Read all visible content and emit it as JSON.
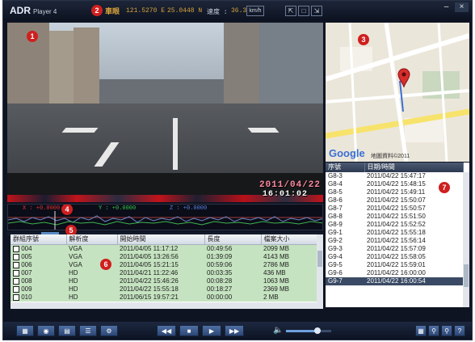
{
  "app": {
    "title": "ADR",
    "subtitle": "Player 4"
  },
  "badges": [
    "1",
    "2",
    "3",
    "4",
    "5",
    "6",
    "7"
  ],
  "header": {
    "logo_text": "車眼",
    "longitude": "121.5270 E",
    "latitude": "25.0448 N",
    "speed_label": "速度 :",
    "speed_value": "36.3",
    "speed_unit": "km/h"
  },
  "window_controls": [
    "–",
    "×"
  ],
  "video": {
    "date": "2011/04/22",
    "time": "16:01:02"
  },
  "map": {
    "provider": "Google",
    "attribution": "地圖資料©2011"
  },
  "sensor": {
    "x_label": "X : +0.0000",
    "y_label": "Y : +0.0000",
    "z_label": "Z : +0.0000"
  },
  "file_list": {
    "headers": [
      "群組序號",
      "解析度",
      "開始時間",
      "長度",
      "檔案大小"
    ],
    "rows": [
      [
        "004",
        "VGA",
        "2011/04/05 11:17:12",
        "00:49:56",
        "2099 MB"
      ],
      [
        "005",
        "VGA",
        "2011/04/05 13:26:56",
        "01:39:09",
        "4143 MB"
      ],
      [
        "006",
        "VGA",
        "2011/04/05 15:21:15",
        "00:59:06",
        "2786 MB"
      ],
      [
        "007",
        "HD",
        "2011/04/21 11:22:46",
        "00:03:35",
        "436 MB"
      ],
      [
        "008",
        "HD",
        "2011/04/22 15:46:26",
        "00:08:28",
        "1063 MB"
      ],
      [
        "009",
        "HD",
        "2011/04/22 15:55:18",
        "00:18:27",
        "2369 MB"
      ],
      [
        "010",
        "HD",
        "2011/06/15 19:57:21",
        "00:00:00",
        "2 MB"
      ]
    ]
  },
  "gps_list": {
    "headers": [
      "序號",
      "日期/時間"
    ],
    "rows": [
      [
        "G8-3",
        "2011/04/22 15:47:17"
      ],
      [
        "G8-4",
        "2011/04/22 15:48:15"
      ],
      [
        "G8-5",
        "2011/04/22 15:49:11"
      ],
      [
        "G8-6",
        "2011/04/22 15:50:07"
      ],
      [
        "G8-7",
        "2011/04/22 15:50:57"
      ],
      [
        "G8-8",
        "2011/04/22 15:51:50"
      ],
      [
        "G8-9",
        "2011/04/22 15:52:52"
      ],
      [
        "G9-1",
        "2011/04/22 15:55:18"
      ],
      [
        "G9-2",
        "2011/04/22 15:56:14"
      ],
      [
        "G9-3",
        "2011/04/22 15:57:09"
      ],
      [
        "G9-4",
        "2011/04/22 15:58:05"
      ],
      [
        "G9-5",
        "2011/04/22 15:59:01"
      ],
      [
        "G9-6",
        "2011/04/22 16:00:00"
      ],
      [
        "G9-7",
        "2011/04/22 16:00:54"
      ]
    ]
  },
  "controls": {
    "volume_level": 0.7
  },
  "colors": {
    "badge": "#cf1f1f",
    "gps_text": "#d8a23a",
    "row_green": "#c5e3c0",
    "glitch_red": "#c2131a"
  }
}
